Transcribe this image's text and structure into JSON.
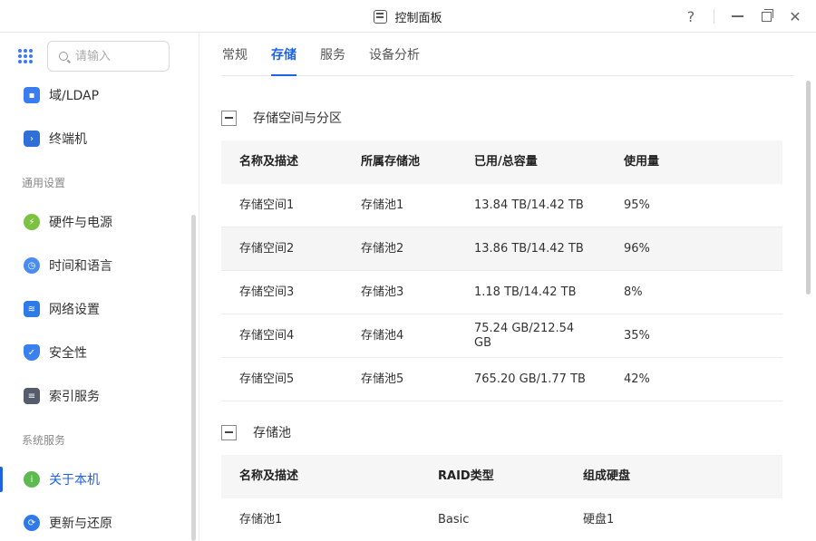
{
  "window": {
    "title": "控制面板"
  },
  "search": {
    "placeholder": "请输入"
  },
  "sidebar": {
    "items_top": [
      {
        "label": "域/LDAP",
        "icon": "domain-ldap-icon"
      },
      {
        "label": "终端机",
        "icon": "terminal-icon"
      }
    ],
    "section1": "通用设置",
    "items_general": [
      {
        "label": "硬件与电源",
        "icon": "hardware-power-icon"
      },
      {
        "label": "时间和语言",
        "icon": "time-language-icon"
      },
      {
        "label": "网络设置",
        "icon": "network-icon"
      },
      {
        "label": "安全性",
        "icon": "shield-icon"
      },
      {
        "label": "索引服务",
        "icon": "index-service-icon"
      }
    ],
    "section2": "系统服务",
    "items_system": [
      {
        "label": "关于本机",
        "icon": "info-icon",
        "active": true
      },
      {
        "label": "更新与还原",
        "icon": "update-restore-icon"
      }
    ]
  },
  "tabs": [
    {
      "label": "常规"
    },
    {
      "label": "存储",
      "active": true
    },
    {
      "label": "服务"
    },
    {
      "label": "设备分析"
    }
  ],
  "storage_spaces": {
    "title": "存储空间与分区",
    "headers": [
      "名称及描述",
      "所属存储池",
      "已用/总容量",
      "使用量"
    ],
    "rows": [
      [
        "存储空间1",
        "存储池1",
        "13.84 TB/14.42 TB",
        "95%"
      ],
      [
        "存储空间2",
        "存储池2",
        "13.86 TB/14.42 TB",
        "96%"
      ],
      [
        "存储空间3",
        "存储池3",
        "1.18 TB/14.42 TB",
        "8%"
      ],
      [
        "存储空间4",
        "存储池4",
        "75.24 GB/212.54 GB",
        "35%"
      ],
      [
        "存储空间5",
        "存储池5",
        "765.20 GB/1.77 TB",
        "42%"
      ]
    ]
  },
  "storage_pools": {
    "title": "存储池",
    "headers": [
      "名称及描述",
      "RAID类型",
      "组成硬盘"
    ],
    "rows": [
      [
        "存储池1",
        "Basic",
        "硬盘1"
      ]
    ]
  },
  "colors": {
    "accent": "#1e62e8"
  }
}
